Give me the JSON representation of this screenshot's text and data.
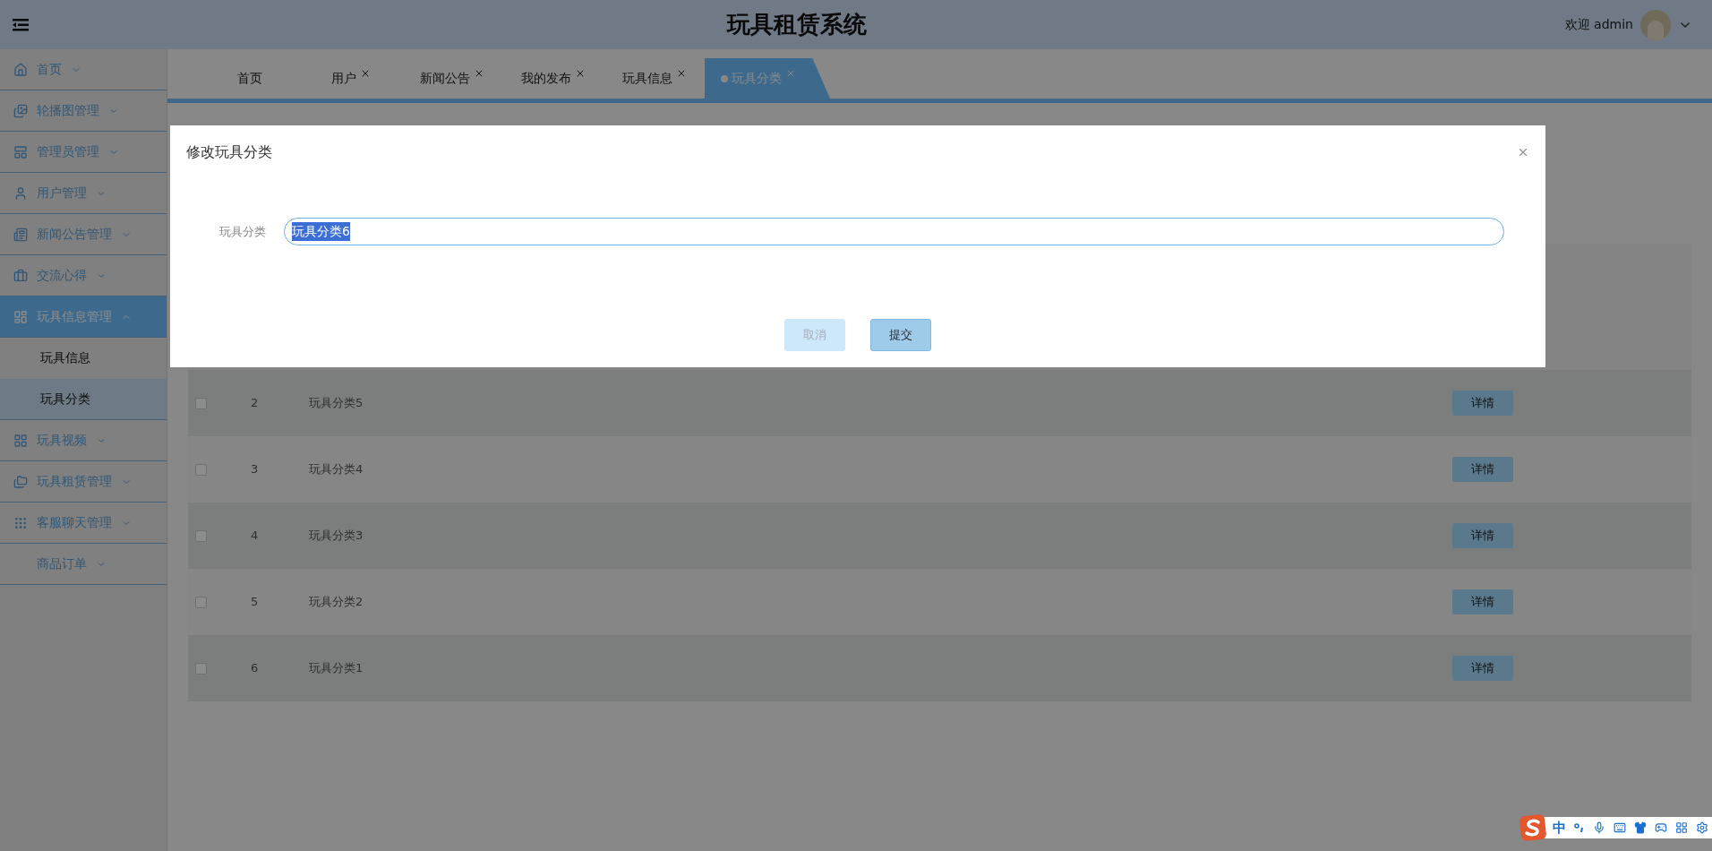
{
  "header": {
    "title": "玩具租赁系统",
    "welcome": "欢迎 admin"
  },
  "sidebar": {
    "items": [
      {
        "label": "首页",
        "expanded": false,
        "selected": false
      },
      {
        "label": "轮播图管理",
        "expanded": false,
        "selected": false
      },
      {
        "label": "管理员管理",
        "expanded": false,
        "selected": false
      },
      {
        "label": "用户管理",
        "expanded": false,
        "selected": false
      },
      {
        "label": "新闻公告管理",
        "expanded": false,
        "selected": false
      },
      {
        "label": "交流心得",
        "expanded": false,
        "selected": false
      },
      {
        "label": "玩具信息管理",
        "expanded": true,
        "selected": true,
        "children": [
          {
            "label": "玩具信息",
            "selected": false
          },
          {
            "label": "玩具分类",
            "selected": true
          }
        ]
      },
      {
        "label": "玩具视频",
        "expanded": false,
        "selected": false
      },
      {
        "label": "玩具租赁管理",
        "expanded": false,
        "selected": false
      },
      {
        "label": "客服聊天管理",
        "expanded": false,
        "selected": false
      },
      {
        "label": "商品订单",
        "expanded": false,
        "selected": false
      }
    ]
  },
  "tabs": [
    {
      "label": "首页",
      "closable": false,
      "selected": false
    },
    {
      "label": "用户",
      "closable": true,
      "selected": false
    },
    {
      "label": "新闻公告",
      "closable": true,
      "selected": false
    },
    {
      "label": "我的发布",
      "closable": true,
      "selected": false
    },
    {
      "label": "玩具信息",
      "closable": true,
      "selected": false
    },
    {
      "label": "玩具分类",
      "closable": true,
      "selected": true
    }
  ],
  "table": {
    "rows": [
      {
        "checked": false,
        "index": "2",
        "name": "玩具分类5",
        "action": "详情"
      },
      {
        "checked": false,
        "index": "3",
        "name": "玩具分类4",
        "action": "详情"
      },
      {
        "checked": false,
        "index": "4",
        "name": "玩具分类3",
        "action": "详情"
      },
      {
        "checked": false,
        "index": "5",
        "name": "玩具分类2",
        "action": "详情"
      },
      {
        "checked": false,
        "index": "6",
        "name": "玩具分类1",
        "action": "详情"
      }
    ]
  },
  "dialog": {
    "title": "修改玩具分类",
    "field": {
      "label": "玩具分类",
      "value": "玩具分类6",
      "text_selected": true
    },
    "buttons": [
      {
        "label": "取消",
        "kind": "secondary"
      },
      {
        "label": "提交",
        "kind": "primary"
      }
    ]
  },
  "ime_bar": {
    "mode": "中"
  }
}
